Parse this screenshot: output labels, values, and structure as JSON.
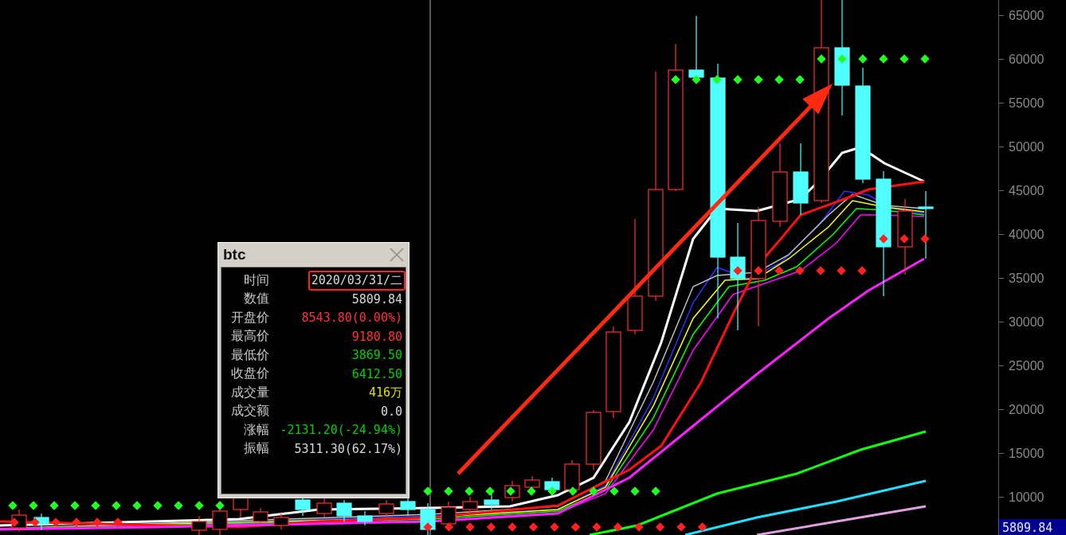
{
  "popup": {
    "title": "btc",
    "rows": [
      {
        "label": "时间",
        "value": "2020/03/31/二",
        "color": "#d8d8d8",
        "highlighted": true
      },
      {
        "label": "数值",
        "value": "5809.84",
        "color": "#d8d8d8",
        "highlighted": false
      },
      {
        "label": "开盘价",
        "value": "8543.80(0.00%)",
        "color": "#ff3232",
        "highlighted": false
      },
      {
        "label": "最高价",
        "value": "9180.80",
        "color": "#ff3232",
        "highlighted": false
      },
      {
        "label": "最低价",
        "value": "3869.50",
        "color": "#00d000",
        "highlighted": false
      },
      {
        "label": "收盘价",
        "value": "6412.50",
        "color": "#00d000",
        "highlighted": false
      },
      {
        "label": "成交量",
        "value": "416万",
        "color": "#e0e000",
        "highlighted": false
      },
      {
        "label": "成交额",
        "value": "0.0",
        "color": "#d8d8d8",
        "highlighted": false
      },
      {
        "label": "涨幅",
        "value": "-2131.20(-24.94%)",
        "color": "#00d000",
        "highlighted": false
      },
      {
        "label": "振幅",
        "value": "5311.30(62.17%)",
        "color": "#d8d8d8",
        "highlighted": false
      }
    ]
  },
  "price_axis": {
    "ticks": [
      "65000",
      "60000",
      "55000",
      "50000",
      "45000",
      "40000",
      "35000",
      "30000",
      "25000",
      "20000",
      "15000",
      "10000"
    ],
    "current_price": "5809.84"
  }
}
